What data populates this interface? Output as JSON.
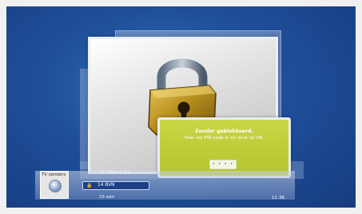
{
  "dialog": {
    "title": "Zender geblokkeerd.",
    "message": "Voer uw PIN-code in en druk op OK.",
    "pin_value": "• • • •"
  },
  "channel_bar": {
    "label": "TV zenders",
    "previous": "13  \"Film 1.3 2...",
    "selected_lock": "🔒",
    "selected": "14  BVN",
    "next": "15  een",
    "time": "11:36"
  },
  "colors": {
    "background": "#1f4f9a",
    "dialog": "#c0cf3a",
    "selected_row": "#1e3f86",
    "padlock": "#b08a1e"
  },
  "icons": {
    "lock_image": "padlock-icon",
    "channel_icon": "tv-channels-icon",
    "row_lock": "lock-icon"
  }
}
